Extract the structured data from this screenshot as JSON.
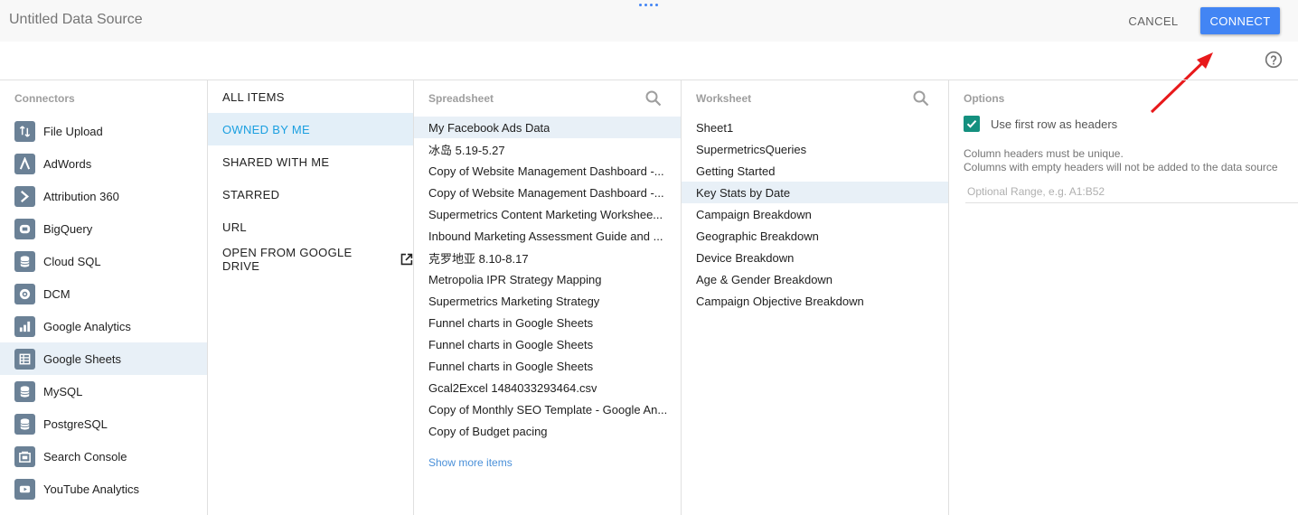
{
  "header": {
    "title": "Untitled Data Source",
    "cancel_label": "CANCEL",
    "connect_label": "CONNECT"
  },
  "colors": {
    "accent": "#4285f4",
    "connector_icon": "#6b8196",
    "checkbox": "#14907f",
    "selected_nav_text": "#1a9fe0",
    "annotation_arrow": "#e8191b"
  },
  "connectors": {
    "header": "Connectors",
    "items": [
      {
        "label": "File Upload",
        "icon": "file-upload-icon"
      },
      {
        "label": "AdWords",
        "icon": "adwords-icon"
      },
      {
        "label": "Attribution 360",
        "icon": "attribution-icon"
      },
      {
        "label": "BigQuery",
        "icon": "bigquery-icon"
      },
      {
        "label": "Cloud SQL",
        "icon": "database-icon"
      },
      {
        "label": "DCM",
        "icon": "dcm-icon"
      },
      {
        "label": "Google Analytics",
        "icon": "analytics-icon"
      },
      {
        "label": "Google Sheets",
        "icon": "sheets-icon",
        "selected": true
      },
      {
        "label": "MySQL",
        "icon": "database-icon"
      },
      {
        "label": "PostgreSQL",
        "icon": "database-icon"
      },
      {
        "label": "Search Console",
        "icon": "search-console-icon"
      },
      {
        "label": "YouTube Analytics",
        "icon": "youtube-icon"
      }
    ]
  },
  "nav": {
    "items": [
      {
        "label": "ALL ITEMS"
      },
      {
        "label": "OWNED BY ME",
        "selected": true
      },
      {
        "label": "SHARED WITH ME"
      },
      {
        "label": "STARRED"
      },
      {
        "label": "URL"
      },
      {
        "label": "OPEN FROM GOOGLE DRIVE",
        "icon": "open-in-new-icon"
      }
    ]
  },
  "spreadsheet": {
    "header": "Spreadsheet",
    "items": [
      "My Facebook Ads Data",
      "冰岛 5.19-5.27",
      "Copy of Website Management Dashboard -...",
      "Copy of Website Management Dashboard -...",
      "Supermetrics Content Marketing Workshee...",
      "Inbound Marketing Assessment Guide and ...",
      "克罗地亚 8.10-8.17",
      "Metropolia IPR Strategy Mapping",
      "Supermetrics Marketing Strategy",
      "Funnel charts in Google Sheets",
      "Funnel charts in Google Sheets",
      "Funnel charts in Google Sheets",
      "Gcal2Excel 1484033293464.csv",
      "Copy of Monthly SEO Template - Google An...",
      "Copy of Budget pacing"
    ],
    "selected_index": 0,
    "show_more": "Show more items"
  },
  "worksheet": {
    "header": "Worksheet",
    "items": [
      "Sheet1",
      "SupermetricsQueries",
      "Getting Started",
      "Key Stats by Date",
      "Campaign Breakdown",
      "Geographic Breakdown",
      "Device Breakdown",
      "Age & Gender Breakdown",
      "Campaign Objective Breakdown"
    ],
    "selected_index": 3
  },
  "options": {
    "header": "Options",
    "checkbox_label": "Use first row as headers",
    "checkbox_checked": true,
    "note_line1": "Column headers must be unique.",
    "note_line2": "Columns with empty headers will not be added to the data source",
    "range_placeholder": "Optional Range, e.g. A1:B52",
    "range_value": ""
  }
}
